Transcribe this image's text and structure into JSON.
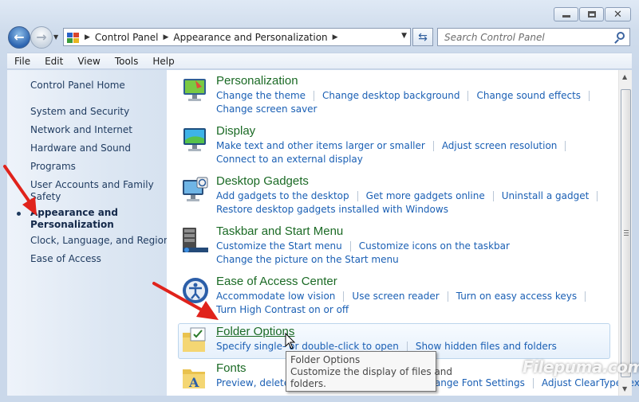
{
  "window": {
    "address": [
      "Control Panel",
      "Appearance and Personalization"
    ],
    "search_placeholder": "Search Control Panel"
  },
  "menu": [
    "File",
    "Edit",
    "View",
    "Tools",
    "Help"
  ],
  "sidebar": {
    "home": "Control Panel Home",
    "items": [
      "System and Security",
      "Network and Internet",
      "Hardware and Sound",
      "Programs",
      "User Accounts and Family Safety"
    ],
    "active": [
      "Appearance and",
      "Personalization"
    ],
    "items_after": [
      "Clock, Language, and Region",
      "Ease of Access"
    ]
  },
  "categories": [
    {
      "title": "Personalization",
      "icon": "personalization-icon",
      "line1": [
        "Change the theme",
        "Change desktop background",
        "Change sound effects"
      ],
      "line2": [
        "Change screen saver"
      ]
    },
    {
      "title": "Display",
      "icon": "display-icon",
      "line1": [
        "Make text and other items larger or smaller",
        "Adjust screen resolution"
      ],
      "line2": [
        "Connect to an external display"
      ]
    },
    {
      "title": "Desktop Gadgets",
      "icon": "gadgets-icon",
      "line1": [
        "Add gadgets to the desktop",
        "Get more gadgets online",
        "Uninstall a gadget"
      ],
      "line2": [
        "Restore desktop gadgets installed with Windows"
      ]
    },
    {
      "title": "Taskbar and Start Menu",
      "icon": "taskbar-icon",
      "line1": [
        "Customize the Start menu",
        "Customize icons on the taskbar"
      ],
      "line2": [
        "Change the picture on the Start menu"
      ]
    },
    {
      "title": "Ease of Access Center",
      "icon": "ease-of-access-icon",
      "line1": [
        "Accommodate low vision",
        "Use screen reader",
        "Turn on easy access keys"
      ],
      "line2": [
        "Turn High Contrast on or off"
      ]
    },
    {
      "title": "Folder Options",
      "icon": "folder-options-icon",
      "line1": [
        "Specify single- or double-click to open",
        "Show hidden files and folders"
      ],
      "line2": []
    },
    {
      "title": "Fonts",
      "icon": "fonts-icon",
      "line1": [
        "Preview, delete, or show and hide fonts",
        "Change Font Settings",
        "Adjust ClearType text"
      ],
      "line2": []
    }
  ],
  "tooltip": {
    "title": "Folder Options",
    "text_line1": "Customize the display of files and",
    "text_line2": "folders."
  },
  "watermark": "Filepuma.com",
  "colors": {
    "link": "#1a5fb4",
    "category_title": "#1b6a25",
    "annotation_arrow": "#e0231c"
  }
}
